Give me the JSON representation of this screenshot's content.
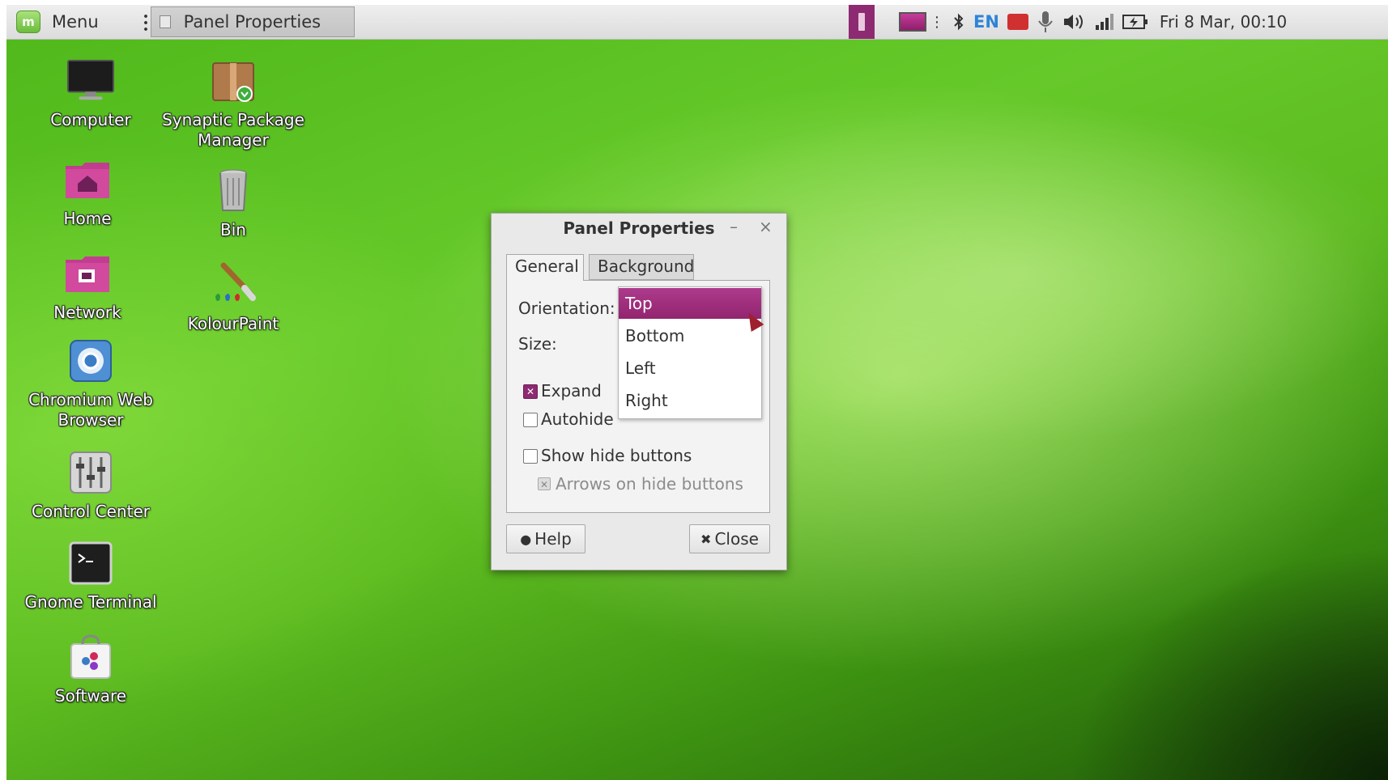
{
  "top_panel": {
    "menu_label": "Menu",
    "task_label": "Panel Properties",
    "lang": "EN",
    "clock": "Fri  8 Mar, 00:10",
    "accent": "#8d2a72"
  },
  "desktop": {
    "icons": [
      {
        "label": "Computer",
        "icon": "monitor-icon"
      },
      {
        "label": "Synaptic Package Manager",
        "icon": "package-icon"
      },
      {
        "label": "Home",
        "icon": "home-folder-icon"
      },
      {
        "label": "Bin",
        "icon": "trash-icon"
      },
      {
        "label": "Network",
        "icon": "network-folder-icon"
      },
      {
        "label": "KolourPaint",
        "icon": "paint-icon"
      },
      {
        "label": "Chromium Web Browser",
        "icon": "chromium-icon"
      },
      {
        "label": "Control Center",
        "icon": "sliders-icon"
      },
      {
        "label": "Gnome Terminal",
        "icon": "terminal-icon"
      },
      {
        "label": "Software",
        "icon": "software-bag-icon"
      }
    ]
  },
  "dialog": {
    "title": "Panel Properties",
    "minimize": "–",
    "close": "×",
    "tabs": [
      "General",
      "Background"
    ],
    "orientation_label": "Orientation:",
    "size_label": "Size:",
    "orientation_options": [
      "Top",
      "Bottom",
      "Left",
      "Right"
    ],
    "selected_orientation": "Top",
    "expand": {
      "label": "Expand",
      "checked": true
    },
    "autohide": {
      "label": "Autohide",
      "checked": false
    },
    "show_hide_buttons": {
      "label": "Show hide buttons",
      "checked": false
    },
    "arrows_on_hide_buttons": {
      "label": "Arrows on hide buttons",
      "checked": true,
      "disabled": true
    },
    "help_label": "Help",
    "close_label": "Close"
  }
}
